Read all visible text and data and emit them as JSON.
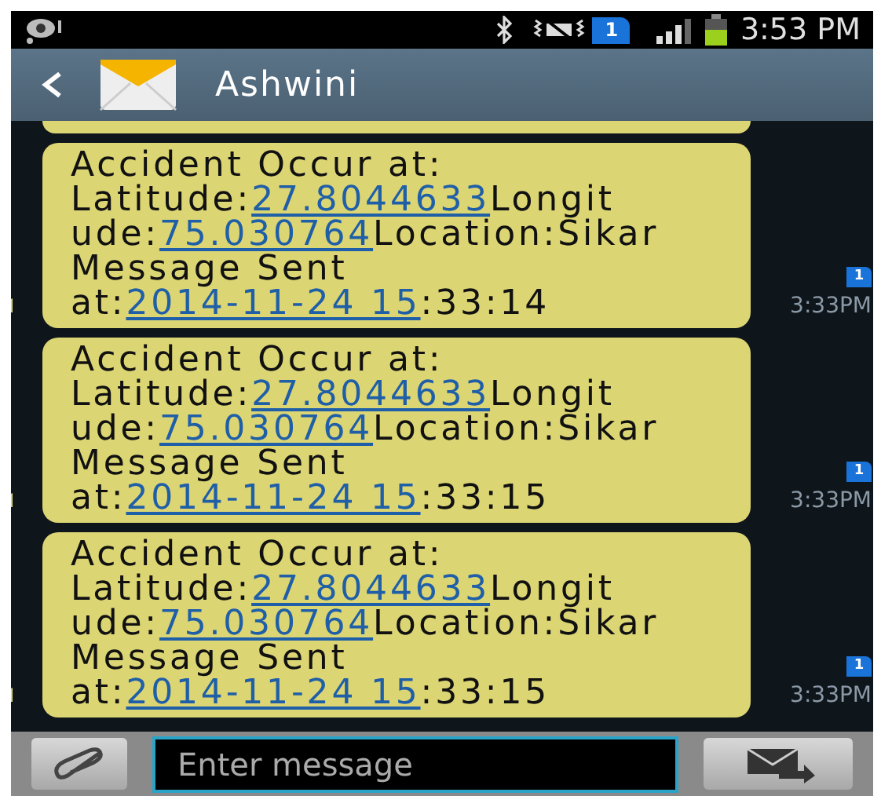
{
  "status_bar": {
    "sim": "1",
    "time": "3:53 PM"
  },
  "header": {
    "contact": "Ashwini"
  },
  "messages": [
    {
      "lines": [
        [
          {
            "text": "Accident Occur at:",
            "link": false
          }
        ],
        [
          {
            "text": "Latitude:",
            "link": false
          },
          {
            "text": "27.8044633",
            "link": true
          },
          {
            "text": "Longit",
            "link": false
          }
        ],
        [
          {
            "text": "ude:",
            "link": false
          },
          {
            "text": "75.030764",
            "link": true
          },
          {
            "text": "Location:Sikar",
            "link": false
          }
        ],
        [
          {
            "text": "Message Sent",
            "link": false
          }
        ],
        [
          {
            "text": "at:",
            "link": false
          },
          {
            "text": "2014-11-24 15",
            "link": true
          },
          {
            "text": ":33:14",
            "link": false
          }
        ]
      ],
      "sim": "1",
      "time": "3:33PM"
    },
    {
      "lines": [
        [
          {
            "text": "Accident Occur at:",
            "link": false
          }
        ],
        [
          {
            "text": "Latitude:",
            "link": false
          },
          {
            "text": "27.8044633",
            "link": true
          },
          {
            "text": "Longit",
            "link": false
          }
        ],
        [
          {
            "text": "ude:",
            "link": false
          },
          {
            "text": "75.030764",
            "link": true
          },
          {
            "text": "Location:Sikar",
            "link": false
          }
        ],
        [
          {
            "text": "Message Sent",
            "link": false
          }
        ],
        [
          {
            "text": "at:",
            "link": false
          },
          {
            "text": "2014-11-24 15",
            "link": true
          },
          {
            "text": ":33:15",
            "link": false
          }
        ]
      ],
      "sim": "1",
      "time": "3:33PM"
    },
    {
      "lines": [
        [
          {
            "text": "Accident Occur at:",
            "link": false
          }
        ],
        [
          {
            "text": "Latitude:",
            "link": false
          },
          {
            "text": "27.8044633",
            "link": true
          },
          {
            "text": "Longit",
            "link": false
          }
        ],
        [
          {
            "text": "ude:",
            "link": false
          },
          {
            "text": "75.030764",
            "link": true
          },
          {
            "text": "Location:Sikar",
            "link": false
          }
        ],
        [
          {
            "text": "Message Sent",
            "link": false
          }
        ],
        [
          {
            "text": "at:",
            "link": false
          },
          {
            "text": "2014-11-24 15",
            "link": true
          },
          {
            "text": ":33:15",
            "link": false
          }
        ]
      ],
      "sim": "1",
      "time": "3:33PM"
    }
  ],
  "composer": {
    "placeholder": "Enter message"
  }
}
